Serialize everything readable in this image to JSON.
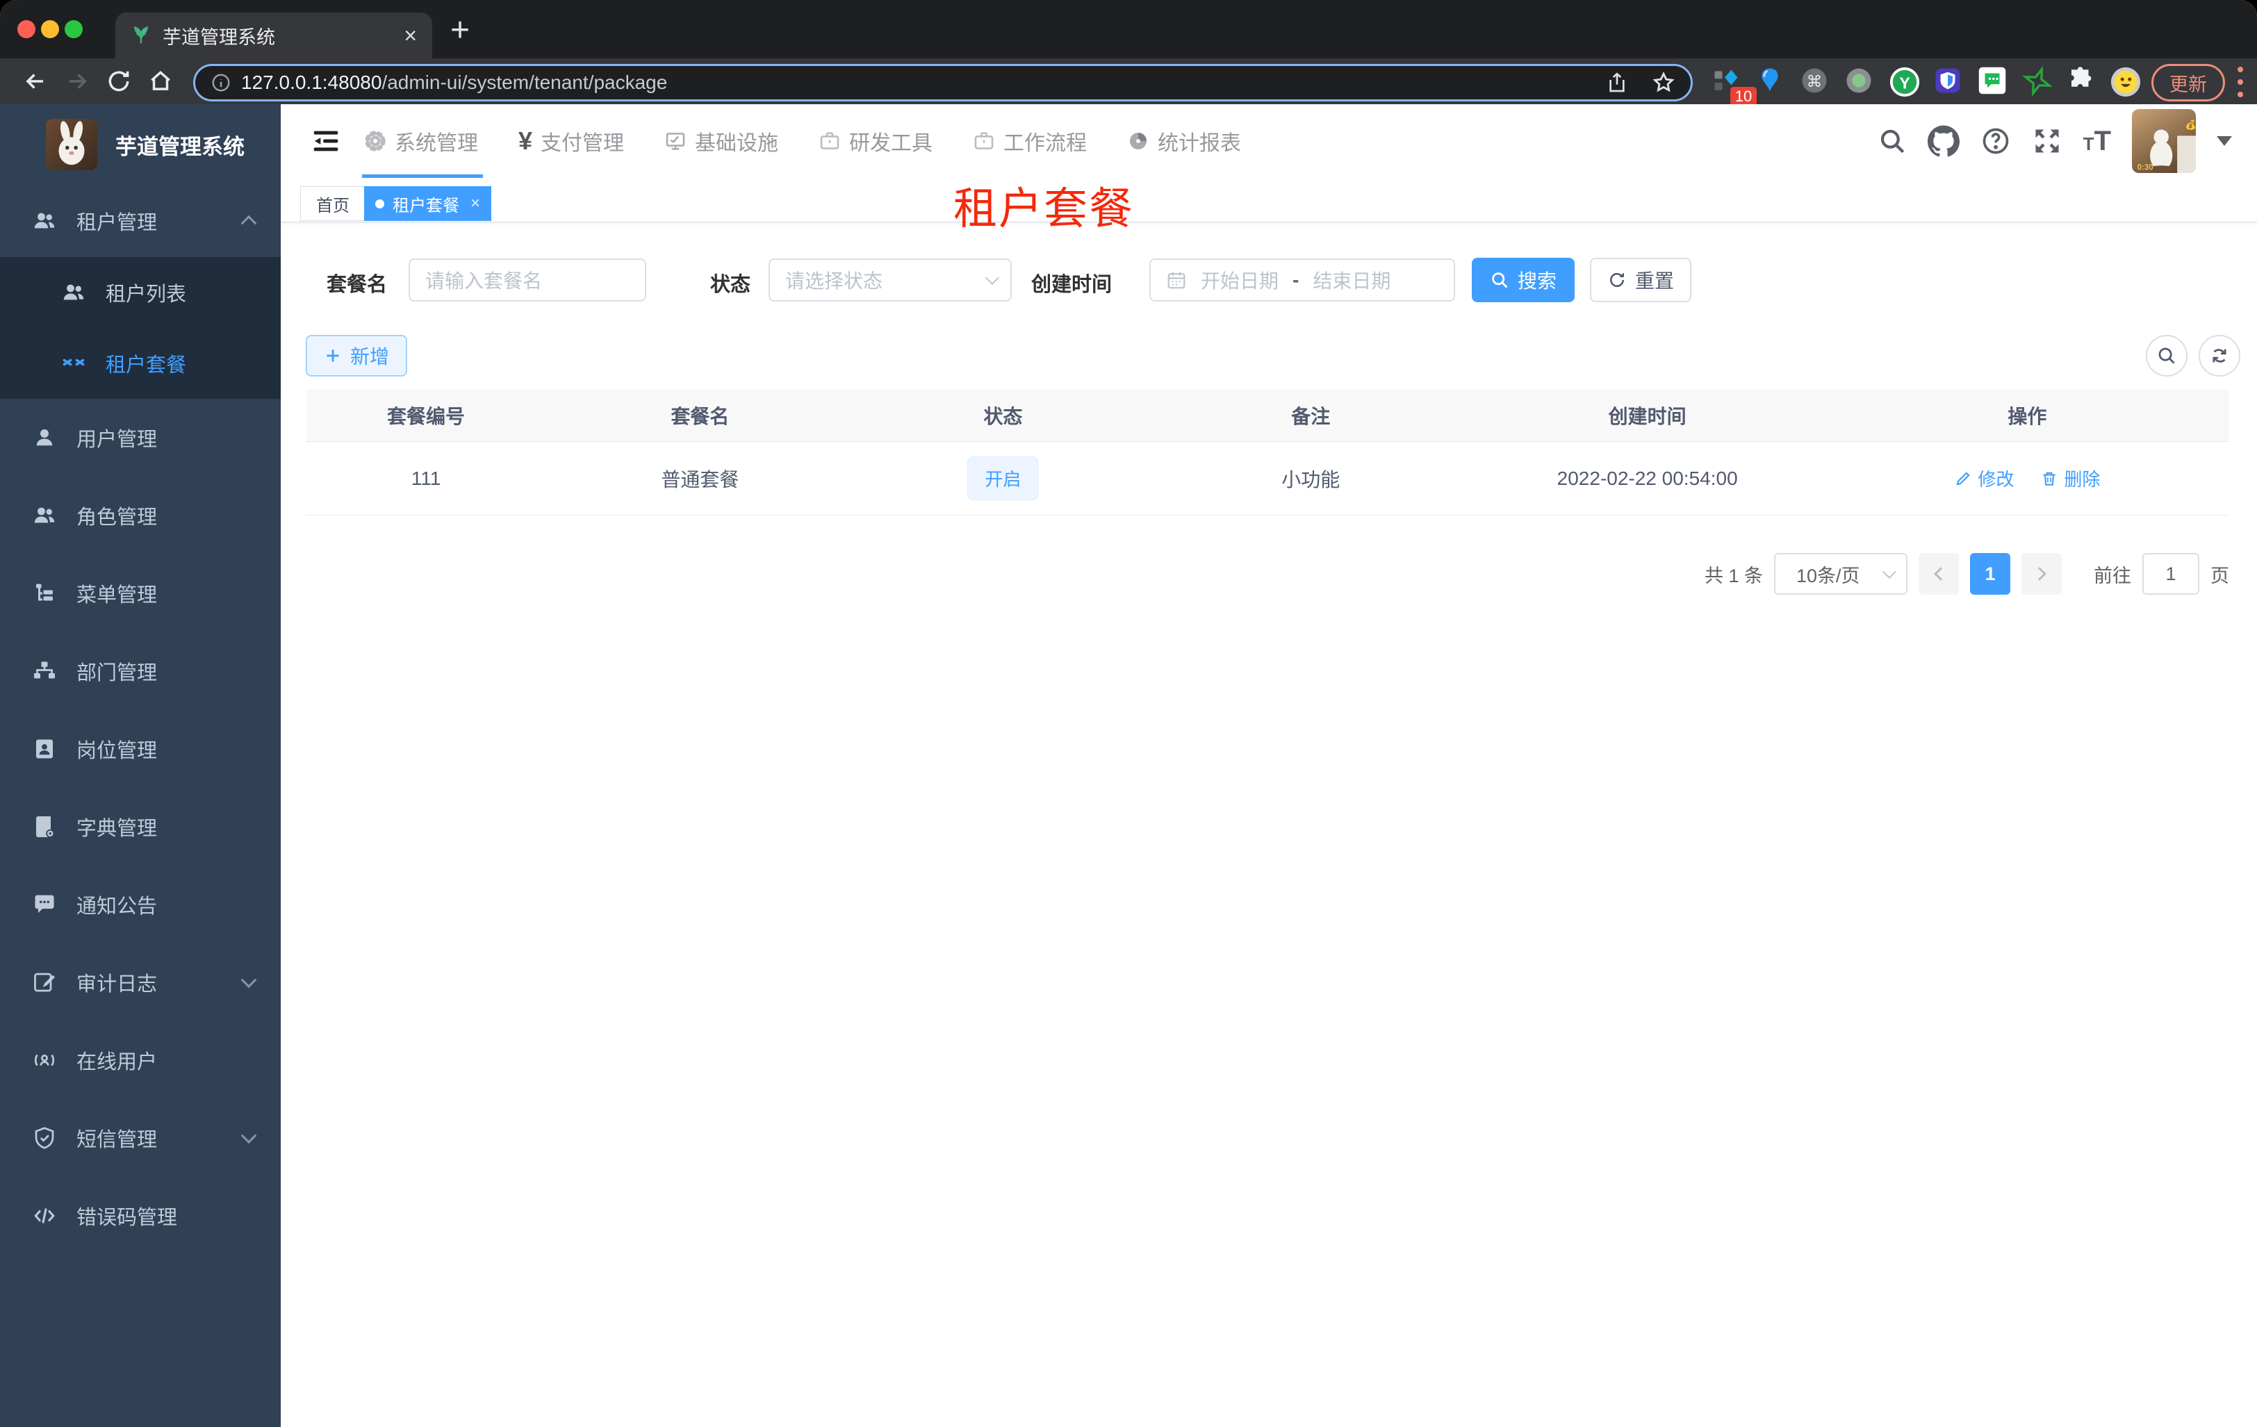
{
  "browser": {
    "tab_title": "芋道管理系统",
    "new_tab": "+",
    "close_tab": "×",
    "url_host": "127.0.0.1:48080",
    "url_path": "/admin-ui/system/tenant/package",
    "extension_badge": "10",
    "update_label": "更新"
  },
  "app": {
    "logo_title": "芋道管理系统",
    "top_menu": [
      {
        "label": "系统管理"
      },
      {
        "label": "支付管理"
      },
      {
        "label": "基础设施"
      },
      {
        "label": "研发工具"
      },
      {
        "label": "工作流程"
      },
      {
        "label": "统计报表"
      }
    ],
    "sidebar": {
      "items": [
        {
          "label": "租户管理"
        },
        {
          "label": "租户列表"
        },
        {
          "label": "租户套餐"
        },
        {
          "label": "用户管理"
        },
        {
          "label": "角色管理"
        },
        {
          "label": "菜单管理"
        },
        {
          "label": "部门管理"
        },
        {
          "label": "岗位管理"
        },
        {
          "label": "字典管理"
        },
        {
          "label": "通知公告"
        },
        {
          "label": "审计日志"
        },
        {
          "label": "在线用户"
        },
        {
          "label": "短信管理"
        },
        {
          "label": "错误码管理"
        }
      ]
    },
    "tags": {
      "home": "首页",
      "active": "租户套餐",
      "close": "×"
    },
    "overlay_text": "租户套餐",
    "filters": {
      "name_label": "套餐名",
      "name_placeholder": "请输入套餐名",
      "status_label": "状态",
      "status_placeholder": "请选择状态",
      "time_label": "创建时间",
      "date_start": "开始日期",
      "date_sep": "-",
      "date_end": "结束日期",
      "search_label": "搜索",
      "reset_label": "重置"
    },
    "toolbar": {
      "add_label": "新增"
    },
    "table": {
      "columns": [
        "套餐编号",
        "套餐名",
        "状态",
        "备注",
        "创建时间",
        "操作"
      ],
      "rows": [
        {
          "id": "111",
          "name": "普通套餐",
          "status": "开启",
          "remark": "小功能",
          "create_time": "2022-02-22 00:54:00",
          "edit": "修改",
          "delete": "删除"
        }
      ]
    },
    "pagination": {
      "total": "共 1 条",
      "page_size": "10条/页",
      "current": "1",
      "goto_label": "前往",
      "goto_value": "1",
      "unit": "页"
    }
  },
  "colors": {
    "accent": "#409eff",
    "sidebar_bg": "#304156",
    "submenu_bg": "#1f2d3d",
    "overlay_red": "#f5280b",
    "tag_bg": "#ecf5ff"
  }
}
